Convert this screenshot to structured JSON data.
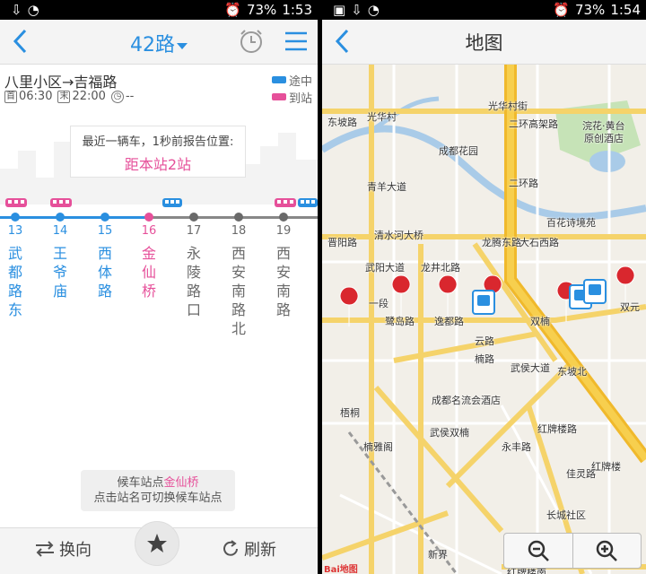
{
  "status_left": {
    "battery": "73%",
    "time": "1:53"
  },
  "status_right": {
    "battery": "73%",
    "time": "1:54"
  },
  "route": {
    "title": "42路",
    "direction": "八里小区→吉福路",
    "first_tag": "首",
    "first_time": "06:30",
    "last_tag": "末",
    "last_time": "22:00",
    "interval": "--"
  },
  "legend": {
    "enroute": "途中",
    "arrived": "到站"
  },
  "report": {
    "line1": "最近一辆车，1秒前报告位置:",
    "line2": "距本站2站"
  },
  "stops": [
    {
      "num": "13",
      "name": "武都路东",
      "state": "passed"
    },
    {
      "num": "14",
      "name": "王爷庙",
      "state": "passed"
    },
    {
      "num": "15",
      "name": "西体路",
      "state": "passed"
    },
    {
      "num": "16",
      "name": "金仙桥",
      "state": "current"
    },
    {
      "num": "17",
      "name": "永陵路口",
      "state": "ahead"
    },
    {
      "num": "18",
      "name": "西安南路北",
      "state": "ahead"
    },
    {
      "num": "19",
      "name": "西安南路",
      "state": "ahead"
    }
  ],
  "tip": {
    "prefix": "候车站点",
    "station": "金仙桥",
    "line2": "点击站名可切换候车站点"
  },
  "bottom": {
    "reverse": "换向",
    "refresh": "刷新"
  },
  "map": {
    "title": "地图",
    "labels": [
      "光华村街",
      "二环高架路",
      "东坡路",
      "光华村",
      "成都花园",
      "浣花·黄台",
      "原创酒店",
      "二环路",
      "百花诗境苑",
      "青羊大道",
      "晋阳路",
      "清水河大桥",
      "龙腾东路",
      "大石西路",
      "武阳大道",
      "一段",
      "龙井北路",
      "鹭岛路",
      "逸都路",
      "双楠",
      "云路",
      "楠路",
      "武侯大道",
      "东坡北",
      "双元",
      "成都名流会酒店",
      "梧桐",
      "武侯双楠",
      "楠雅阁",
      "永丰路",
      "红牌楼路",
      "佳灵路",
      "红牌楼",
      "长城社区",
      "新界",
      "红牌楼南"
    ]
  },
  "colors": {
    "blue": "#2a8fe0",
    "pink": "#e6509a",
    "grey": "#6a6a6a"
  }
}
